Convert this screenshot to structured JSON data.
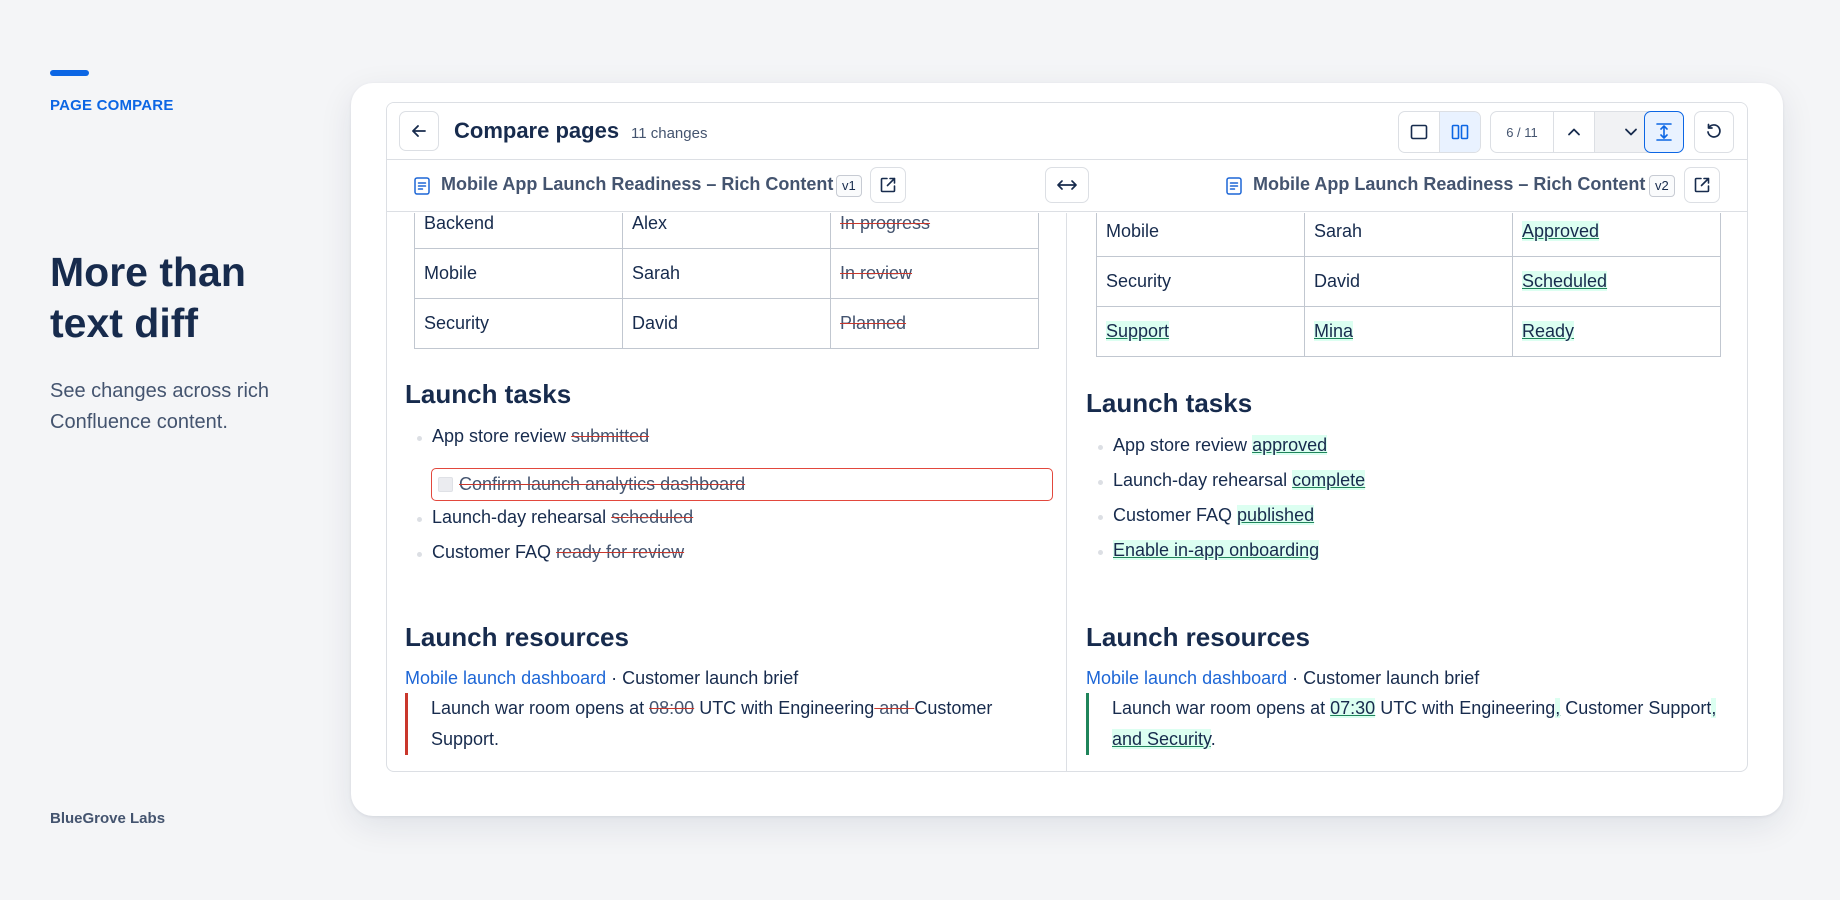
{
  "sidebar": {
    "eyebrow": "PAGE COMPARE",
    "headline": "More than text diff",
    "subtitle": "See changes across rich Confluence content.",
    "brand": "BlueGrove Labs"
  },
  "toolbar": {
    "title": "Compare pages",
    "change_count": "11 changes",
    "pager": "6 / 11"
  },
  "versions": {
    "left": {
      "title": "Mobile App Launch Readiness – Rich Content",
      "badge": "v1"
    },
    "right": {
      "title": "Mobile App Launch Readiness – Rich Content",
      "badge": "v2"
    }
  },
  "left": {
    "table": [
      [
        "Backend",
        "Alex",
        "In progress"
      ],
      [
        "Mobile",
        "Sarah",
        "In review"
      ],
      [
        "Security",
        "David",
        "Planned"
      ]
    ],
    "tasks_heading": "Launch tasks",
    "tasks": [
      {
        "text": "App store review ",
        "removed": "submitted"
      },
      {
        "text": "Launch-day rehearsal ",
        "removed": "scheduled"
      },
      {
        "text": "Customer FAQ ",
        "removed": "ready for review"
      }
    ],
    "removed_task": "Confirm launch analytics dashboard",
    "resources_heading": "Launch resources",
    "resource_link": "Mobile launch dashboard",
    "resource_sep": " · ",
    "resource_text": "Customer launch brief",
    "quote": {
      "a": "Launch war room opens at ",
      "time_removed": "08:00",
      "b": " UTC with Engineering",
      "and_removed": " and ",
      "c": "Customer Support."
    }
  },
  "right": {
    "table": [
      [
        "Mobile",
        "Sarah",
        "Approved"
      ],
      [
        "Security",
        "David",
        "Scheduled"
      ],
      [
        "Support",
        "Mina",
        "Ready"
      ]
    ],
    "tasks_heading": "Launch tasks",
    "tasks": [
      {
        "text": "App store review ",
        "added": "approved"
      },
      {
        "text": "Launch-day rehearsal ",
        "added": "complete"
      },
      {
        "text": "Customer FAQ ",
        "added": "published"
      },
      {
        "text": "",
        "added": "Enable in-app onboarding"
      }
    ],
    "resources_heading": "Launch resources",
    "resource_link": "Mobile launch dashboard",
    "resource_sep": " · ",
    "resource_text": "Customer launch brief",
    "quote": {
      "a": "Launch war room opens at ",
      "time_added": "07:30",
      "b": " UTC with Engineering",
      "comma_added": ",",
      "c": " Customer Support",
      "tail_added": ", and Security",
      "d": "."
    }
  },
  "colors": {
    "accent": "#0c66e4",
    "removed": "#c9372c",
    "added": "#1f845a",
    "added_bg": "#dcfff1"
  }
}
